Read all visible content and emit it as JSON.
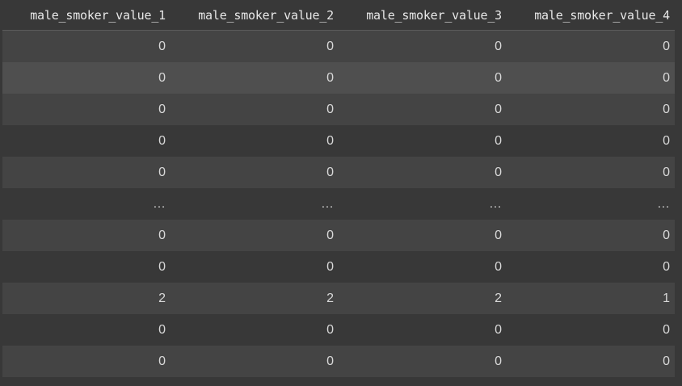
{
  "table": {
    "columns": [
      "male_smoker_value_1",
      "male_smoker_value_2",
      "male_smoker_value_3",
      "male_smoker_value_4"
    ],
    "rows": [
      [
        "0",
        "0",
        "0",
        "0"
      ],
      [
        "0",
        "0",
        "0",
        "0"
      ],
      [
        "0",
        "0",
        "0",
        "0"
      ],
      [
        "0",
        "0",
        "0",
        "0"
      ],
      [
        "0",
        "0",
        "0",
        "0"
      ],
      [
        "…",
        "…",
        "…",
        "…"
      ],
      [
        "0",
        "0",
        "0",
        "0"
      ],
      [
        "0",
        "0",
        "0",
        "0"
      ],
      [
        "2",
        "2",
        "2",
        "1"
      ],
      [
        "0",
        "0",
        "0",
        "0"
      ],
      [
        "0",
        "0",
        "0",
        "0"
      ]
    ]
  }
}
